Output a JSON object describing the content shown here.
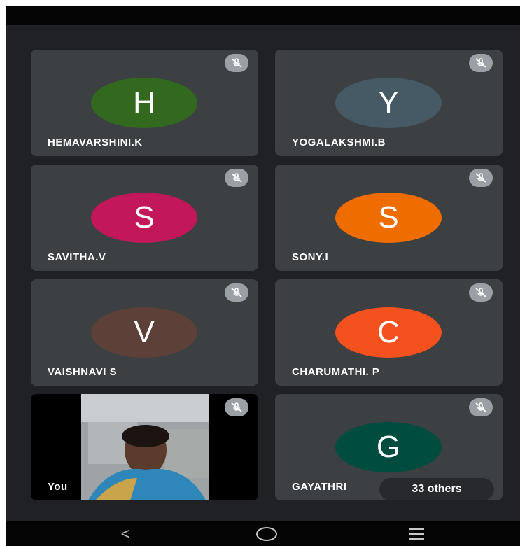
{
  "tiles": [
    {
      "name": "HEMAVARSHINI.K",
      "initial": "H",
      "color": "#33691e"
    },
    {
      "name": "YOGALAKSHMI.B",
      "initial": "Y",
      "color": "#455a64"
    },
    {
      "name": "SAVITHA.V",
      "initial": "S",
      "color": "#c2185b"
    },
    {
      "name": "SONY.I",
      "initial": "S",
      "color": "#ef6c00"
    },
    {
      "name": "VAISHNAVI S",
      "initial": "V",
      "color": "#5d4037"
    },
    {
      "name": "CHARUMATHI. P",
      "initial": "C",
      "color": "#f4511e"
    },
    {
      "name": "GAYATHRI",
      "initial": "G",
      "color": "#004d40"
    }
  ],
  "self_tile": {
    "label": "You"
  },
  "others": "33 others",
  "icons": {
    "mic_off": "mic-off-icon",
    "back": "back-icon",
    "home": "home-icon",
    "recents": "recents-icon"
  },
  "nav": {
    "back_glyph": "<"
  }
}
